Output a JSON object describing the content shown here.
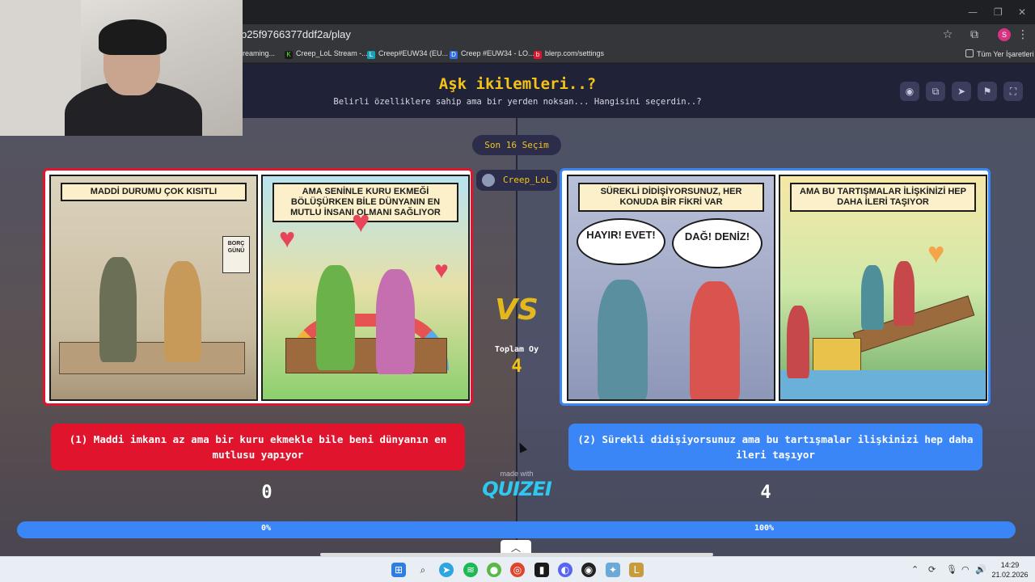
{
  "browser": {
    "url": "b25f9766377ddf2a/play",
    "bookmarks": [
      {
        "label": "reaming...",
        "color": "#5f6368",
        "icon": ""
      },
      {
        "label": "Creep_LoL Stream -...",
        "color": "#1a1a1a",
        "icon": "K"
      },
      {
        "label": "Creep#EUW34 (EU...",
        "color": "#17a2b8",
        "icon": "L"
      },
      {
        "label": "Creep #EUW34 - LO...",
        "color": "#2f6fdf",
        "icon": "D"
      },
      {
        "label": "blerp.com/settings",
        "color": "#e0142c",
        "icon": "b"
      }
    ],
    "all_bookmarks": "Tüm Yer İşaretleri",
    "profile_initial": "S"
  },
  "header": {
    "title": "Aşk ikilemleri..?",
    "subtitle": "Belirli özelliklere sahip ama bir yerden noksan... Hangisini seçerdin..?"
  },
  "round": {
    "label": "Son 16 Seçim",
    "player": "Creep_LoL",
    "total_label": "Toplam Oy",
    "total_value": "4",
    "vs": "VS"
  },
  "left": {
    "panel1_caption": "MADDİ DURUMU ÇOK KISITLI",
    "panel2_caption": "AMA SENİNLE KURU EKMEĞİ BÖLÜŞÜRKEN BİLE DÜNYANIN EN MUTLU İNSANI OLMANI SAĞLIYOR",
    "calendar_text": "BORÇ GÜNÜ",
    "option": "(1) Maddi imkanı az ama bir kuru ekmekle bile beni dünyanın en mutlusu yapıyor",
    "votes": "0",
    "percent": "0%",
    "percent_value": 0
  },
  "right": {
    "panel1_caption": "SÜREKLİ DİDİŞİYORSUNUZ, HER KONUDA BİR FİKRİ VAR",
    "panel2_caption": "AMA BU TARTIŞMALAR İLİŞKİNİZİ HEP DAHA İLERİ TAŞIYOR",
    "bubble_left": "HAYIR! EVET!",
    "bubble_right": "DAĞ! DENİZ!",
    "option": "(2) Sürekli didişiyorsunuz ama bu tartışmalar ilişkinizi hep daha ileri taşıyor",
    "votes": "4",
    "percent": "100%",
    "percent_value": 100
  },
  "footer": {
    "made_with": "made with",
    "logo": "QUIZEI"
  },
  "taskbar": {
    "time": "14:29",
    "date": "21.02.2026"
  },
  "colors": {
    "accent": "#f3c417",
    "red": "#e0142c",
    "blue": "#3b86f7"
  }
}
